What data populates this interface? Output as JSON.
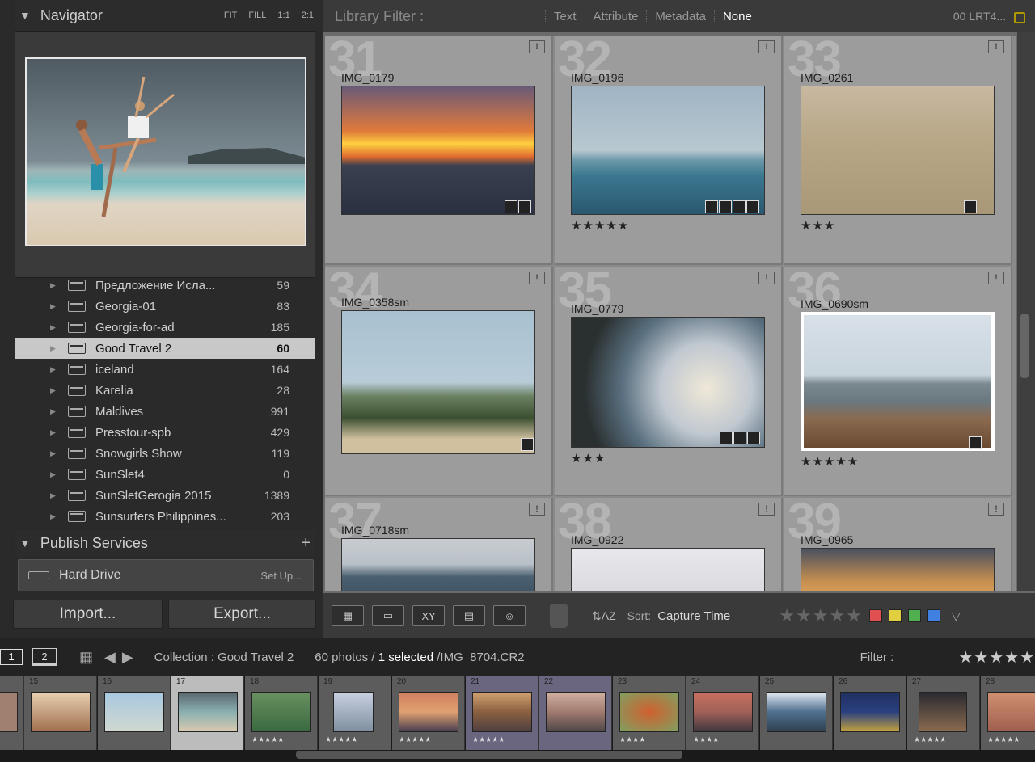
{
  "navigator": {
    "title": "Navigator",
    "modes": [
      "FIT",
      "FILL",
      "1:1",
      "2:1"
    ]
  },
  "collections": [
    {
      "name": "Предложение Исла...",
      "count": "59"
    },
    {
      "name": "Georgia-01",
      "count": "83"
    },
    {
      "name": "Georgia-for-ad",
      "count": "185"
    },
    {
      "name": "Good Travel 2",
      "count": "60",
      "selected": true
    },
    {
      "name": "iceland",
      "count": "164"
    },
    {
      "name": "Karelia",
      "count": "28"
    },
    {
      "name": "Maldives",
      "count": "991"
    },
    {
      "name": "Presstour-spb",
      "count": "429"
    },
    {
      "name": "Snowgirls Show",
      "count": "119"
    },
    {
      "name": "SunSlet4",
      "count": "0"
    },
    {
      "name": "SunSletGerogia 2015",
      "count": "1389"
    },
    {
      "name": "Sunsurfers Philippines...",
      "count": "203"
    }
  ],
  "publish": {
    "title": "Publish Services",
    "plus": "+",
    "hard_drive": "Hard Drive",
    "setup": "Set Up..."
  },
  "buttons": {
    "import": "Import...",
    "export": "Export..."
  },
  "filter_bar": {
    "title": "Library Filter :",
    "tabs": [
      "Text",
      "Attribute",
      "Metadata",
      "None"
    ],
    "active_tab": "None",
    "preset": "00 LRT4..."
  },
  "grid": [
    {
      "num": "31",
      "name": "IMG_0179",
      "stars": ""
    },
    {
      "num": "32",
      "name": "IMG_0196",
      "stars": "★★★★★"
    },
    {
      "num": "33",
      "name": "IMG_0261",
      "stars": "★★★"
    },
    {
      "num": "34",
      "name": "IMG_0358sm",
      "stars": ""
    },
    {
      "num": "35",
      "name": "IMG_0779",
      "stars": "★★★"
    },
    {
      "num": "36",
      "name": "IMG_0690sm",
      "stars": "★★★★★"
    },
    {
      "num": "37",
      "name": "IMG_0718sm",
      "stars": ""
    },
    {
      "num": "38",
      "name": "IMG_0922",
      "stars": ""
    },
    {
      "num": "39",
      "name": "IMG_0965",
      "stars": ""
    }
  ],
  "toolbar": {
    "sort_label": "Sort:",
    "sort_value": "Capture Time",
    "stars": "★★★★★",
    "colors": [
      "#e05050",
      "#e0d040",
      "#50b050",
      "#4080e0"
    ]
  },
  "strip_bar": {
    "monitor1": "1",
    "monitor2": "2",
    "collection": "Collection : Good Travel 2",
    "count_prefix": "60 photos /",
    "selected": "1 selected",
    "path": "/IMG_8704.CR2",
    "filter": "Filter :",
    "stars": "★★★★★"
  },
  "filmstrip": [
    {
      "n": "15",
      "stars": ""
    },
    {
      "n": "16",
      "stars": ""
    },
    {
      "n": "17",
      "stars": ""
    },
    {
      "n": "18",
      "stars": "★★★★★"
    },
    {
      "n": "19",
      "stars": "★★★★★"
    },
    {
      "n": "20",
      "stars": "★★★★★"
    },
    {
      "n": "21",
      "stars": "★★★★★"
    },
    {
      "n": "22",
      "stars": ""
    },
    {
      "n": "23",
      "stars": "★★★★"
    },
    {
      "n": "24",
      "stars": "★★★★"
    },
    {
      "n": "25",
      "stars": ""
    },
    {
      "n": "26",
      "stars": ""
    },
    {
      "n": "27",
      "stars": "★★★★★"
    },
    {
      "n": "28",
      "stars": "★★★★★"
    }
  ]
}
